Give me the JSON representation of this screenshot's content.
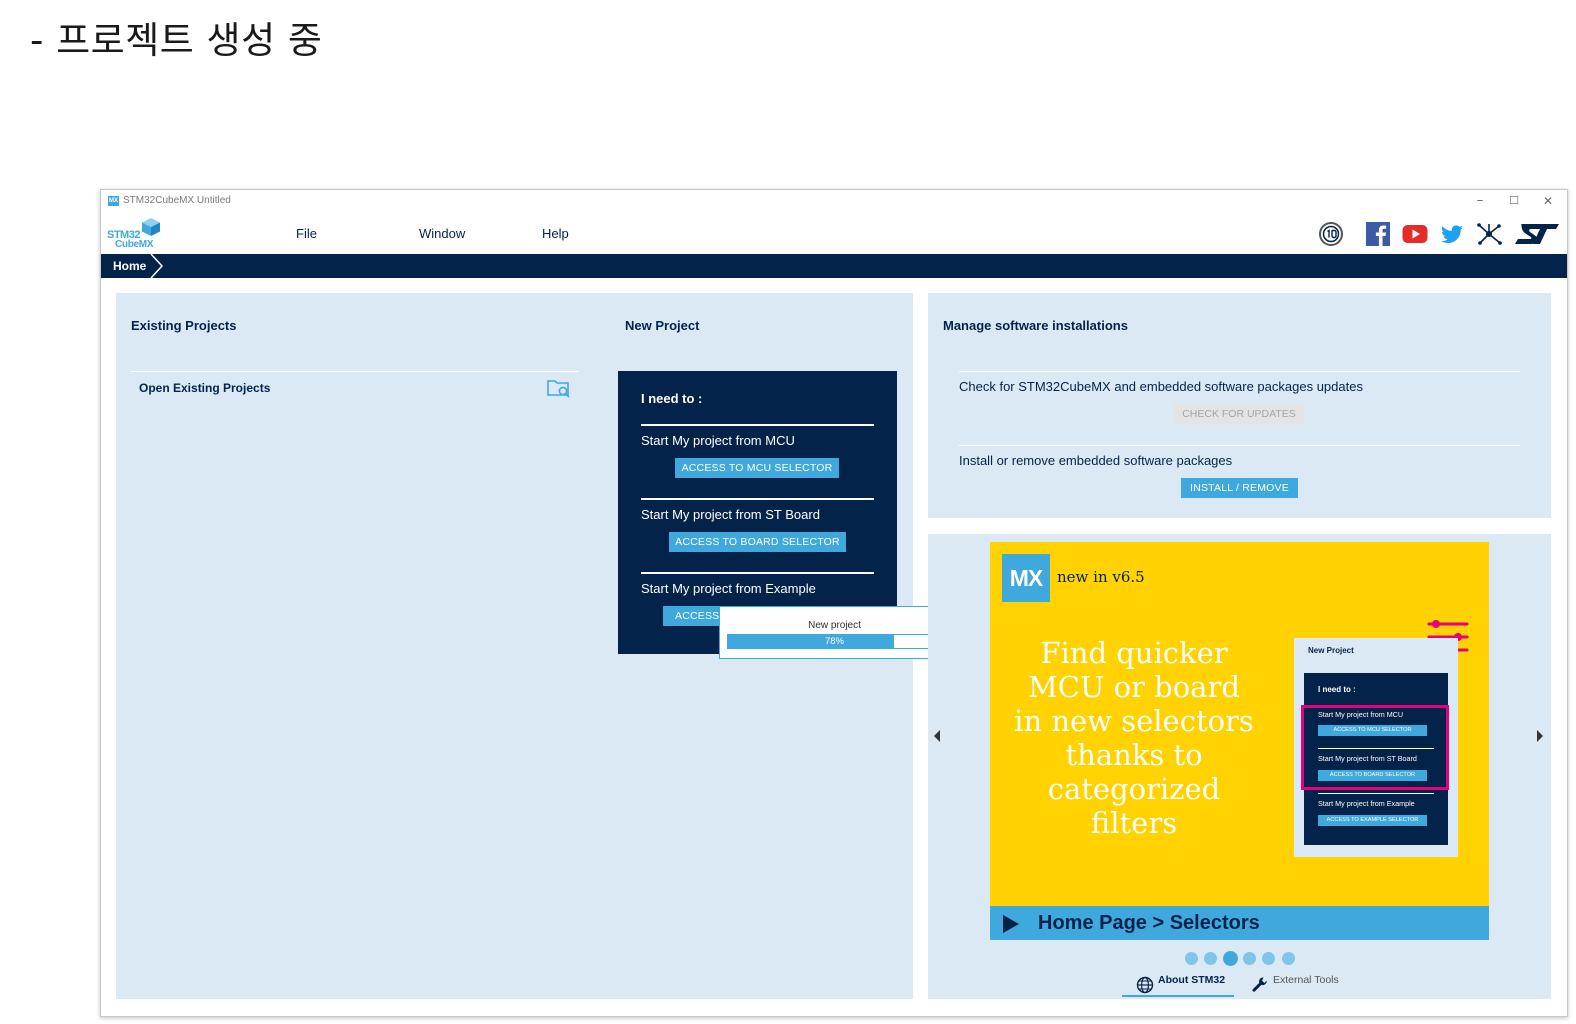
{
  "doc": {
    "heading": "- 프로젝트 생성 중"
  },
  "window": {
    "title": "STM32CubeMX Untitled",
    "app_icon_label": "MX",
    "controls": {
      "minimize": "–",
      "maximize": "☐",
      "close": "✕"
    }
  },
  "logo": {
    "line1": "STM32",
    "line2": "CubeMX"
  },
  "menu": {
    "items": [
      "File",
      "Window",
      "Help"
    ]
  },
  "social_icons": [
    "ten-year-anniversary-icon",
    "facebook-icon",
    "youtube-icon",
    "twitter-icon",
    "network-icon",
    "st-logo-icon"
  ],
  "breadcrumb": {
    "home": "Home"
  },
  "existing_projects": {
    "title": "Existing Projects",
    "open_label": "Open Existing Projects",
    "icon": "folder-search-icon"
  },
  "new_project": {
    "title": "New Project",
    "need_title": "I need to :",
    "options": [
      {
        "label": "Start My project from MCU",
        "button": "ACCESS TO MCU SELECTOR"
      },
      {
        "label": "Start My project from ST Board",
        "button": "ACCESS TO BOARD SELECTOR"
      },
      {
        "label": "Start My project from Example",
        "button": "ACCESS"
      }
    ]
  },
  "progress_dialog": {
    "label": "New project",
    "percent": 78,
    "percent_text": "78%"
  },
  "manage": {
    "title": "Manage software installations",
    "check_text": "Check for STM32CubeMX and embedded software packages updates",
    "check_button": "CHECK FOR UPDATES",
    "install_text": "Install or remove embedded software packages",
    "install_button": "INSTALL / REMOVE"
  },
  "banner": {
    "mx": "MX",
    "new_in": "new in v6.5",
    "headline": [
      "Find quicker",
      "MCU or board",
      "in new selectors",
      "thanks to",
      "categorized",
      "filters"
    ],
    "footer": "Home Page > Selectors",
    "mini": {
      "title": "New Project",
      "need": "I need to :",
      "options": [
        {
          "label": "Start My project from MCU",
          "button": "ACCESS TO MCU SELECTOR"
        },
        {
          "label": "Start My project from ST Board",
          "button": "ACCESS TO BOARD SELECTOR"
        },
        {
          "label": "Start My project from Example",
          "button": "ACCESS TO EXAMPLE SELECTOR"
        }
      ]
    },
    "dots_total": 6,
    "dots_active_index": 2,
    "colors": {
      "yellow": "#ffd200",
      "accent": "#3fa9dd",
      "navy": "#03234b",
      "magenta": "#e6007e"
    }
  },
  "bottom_tabs": {
    "about": "About STM32",
    "external": "External Tools"
  }
}
